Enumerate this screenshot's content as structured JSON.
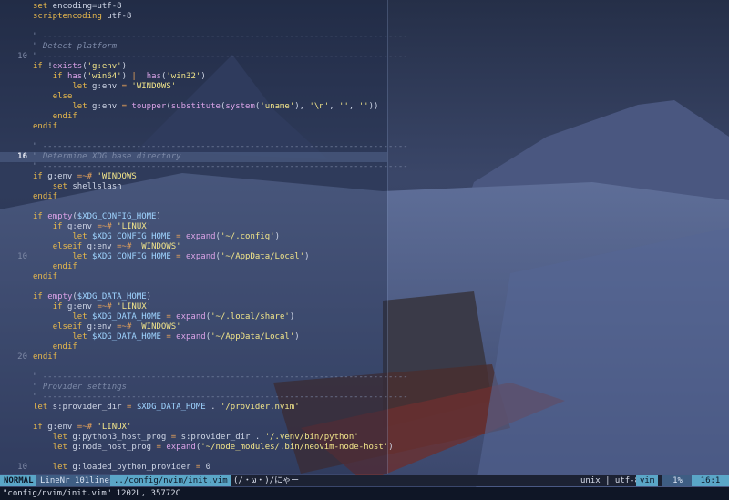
{
  "editor": {
    "lines": [
      {
        "n": "",
        "cur": false,
        "segs": [
          [
            "kw",
            "set"
          ],
          [
            "txt",
            " encoding=utf-8"
          ]
        ]
      },
      {
        "n": "",
        "cur": false,
        "segs": [
          [
            "kw",
            "scriptencoding"
          ],
          [
            "txt",
            " utf-8"
          ]
        ]
      },
      {
        "n": "",
        "cur": false,
        "segs": []
      },
      {
        "n": "",
        "cur": false,
        "segs": [
          [
            "cmt",
            "\" --------------------------------------------------------------------------"
          ]
        ]
      },
      {
        "n": "",
        "cur": false,
        "segs": [
          [
            "cmt",
            "\" Detect platform"
          ]
        ]
      },
      {
        "n": "10",
        "cur": false,
        "segs": [
          [
            "cmt",
            "\" --------------------------------------------------------------------------"
          ]
        ]
      },
      {
        "n": "",
        "cur": false,
        "segs": [
          [
            "kw",
            "if"
          ],
          [
            "txt",
            " !"
          ],
          [
            "fn",
            "exists"
          ],
          [
            "txt",
            "("
          ],
          [
            "str",
            "'g:env'"
          ],
          [
            "txt",
            ")"
          ]
        ]
      },
      {
        "n": "",
        "cur": false,
        "segs": [
          [
            "txt",
            "    "
          ],
          [
            "kw",
            "if"
          ],
          [
            "txt",
            " "
          ],
          [
            "fn",
            "has"
          ],
          [
            "txt",
            "("
          ],
          [
            "str",
            "'win64'"
          ],
          [
            "txt",
            ") "
          ],
          [
            "op",
            "||"
          ],
          [
            "txt",
            " "
          ],
          [
            "fn",
            "has"
          ],
          [
            "txt",
            "("
          ],
          [
            "str",
            "'win32'"
          ],
          [
            "txt",
            ")"
          ]
        ]
      },
      {
        "n": "",
        "cur": false,
        "segs": [
          [
            "txt",
            "        "
          ],
          [
            "kw",
            "let"
          ],
          [
            "txt",
            " g:env "
          ],
          [
            "op",
            "="
          ],
          [
            "txt",
            " "
          ],
          [
            "str",
            "'WINDOWS'"
          ]
        ]
      },
      {
        "n": "",
        "cur": false,
        "segs": [
          [
            "txt",
            "    "
          ],
          [
            "kw",
            "else"
          ]
        ]
      },
      {
        "n": "",
        "cur": false,
        "segs": [
          [
            "txt",
            "        "
          ],
          [
            "kw",
            "let"
          ],
          [
            "txt",
            " g:env "
          ],
          [
            "op",
            "="
          ],
          [
            "txt",
            " "
          ],
          [
            "fn",
            "toupper"
          ],
          [
            "txt",
            "("
          ],
          [
            "fn",
            "substitute"
          ],
          [
            "txt",
            "("
          ],
          [
            "fn",
            "system"
          ],
          [
            "txt",
            "("
          ],
          [
            "str",
            "'uname'"
          ],
          [
            "txt",
            "), "
          ],
          [
            "str",
            "'\\n'"
          ],
          [
            "txt",
            ", "
          ],
          [
            "str",
            "''"
          ],
          [
            "txt",
            ", "
          ],
          [
            "str",
            "''"
          ],
          [
            "txt",
            "))"
          ]
        ]
      },
      {
        "n": "",
        "cur": false,
        "segs": [
          [
            "txt",
            "    "
          ],
          [
            "kw",
            "endif"
          ]
        ]
      },
      {
        "n": "",
        "cur": false,
        "segs": [
          [
            "kw",
            "endif"
          ]
        ]
      },
      {
        "n": "",
        "cur": false,
        "segs": []
      },
      {
        "n": "",
        "cur": false,
        "segs": [
          [
            "cmt",
            "\" --------------------------------------------------------------------------"
          ]
        ]
      },
      {
        "n": "16",
        "cur": true,
        "segs": [
          [
            "cmt",
            "\" Determine XDG base directory"
          ]
        ]
      },
      {
        "n": "",
        "cur": false,
        "segs": [
          [
            "cmt",
            "\" --------------------------------------------------------------------------"
          ]
        ]
      },
      {
        "n": "",
        "cur": false,
        "segs": [
          [
            "kw",
            "if"
          ],
          [
            "txt",
            " g:env "
          ],
          [
            "op",
            "=~#"
          ],
          [
            "txt",
            " "
          ],
          [
            "str",
            "'WINDOWS'"
          ]
        ]
      },
      {
        "n": "",
        "cur": false,
        "segs": [
          [
            "txt",
            "    "
          ],
          [
            "kw",
            "set"
          ],
          [
            "txt",
            " shellslash"
          ]
        ]
      },
      {
        "n": "",
        "cur": false,
        "segs": [
          [
            "kw",
            "endif"
          ]
        ]
      },
      {
        "n": "",
        "cur": false,
        "segs": []
      },
      {
        "n": "",
        "cur": false,
        "segs": [
          [
            "kw",
            "if"
          ],
          [
            "txt",
            " "
          ],
          [
            "fn",
            "empty"
          ],
          [
            "txt",
            "("
          ],
          [
            "var",
            "$XDG_CONFIG_HOME"
          ],
          [
            "txt",
            ")"
          ]
        ]
      },
      {
        "n": "",
        "cur": false,
        "segs": [
          [
            "txt",
            "    "
          ],
          [
            "kw",
            "if"
          ],
          [
            "txt",
            " g:env "
          ],
          [
            "op",
            "=~#"
          ],
          [
            "txt",
            " "
          ],
          [
            "str",
            "'LINUX'"
          ]
        ]
      },
      {
        "n": "",
        "cur": false,
        "segs": [
          [
            "txt",
            "        "
          ],
          [
            "kw",
            "let"
          ],
          [
            "txt",
            " "
          ],
          [
            "var",
            "$XDG_CONFIG_HOME"
          ],
          [
            "txt",
            " "
          ],
          [
            "op",
            "="
          ],
          [
            "txt",
            " "
          ],
          [
            "fn",
            "expand"
          ],
          [
            "txt",
            "("
          ],
          [
            "str",
            "'~/.config'"
          ],
          [
            "txt",
            ")"
          ]
        ]
      },
      {
        "n": "",
        "cur": false,
        "segs": [
          [
            "txt",
            "    "
          ],
          [
            "kw",
            "elseif"
          ],
          [
            "txt",
            " g:env "
          ],
          [
            "op",
            "=~#"
          ],
          [
            "txt",
            " "
          ],
          [
            "str",
            "'WINDOWS'"
          ]
        ]
      },
      {
        "n": "10",
        "cur": false,
        "segs": [
          [
            "txt",
            "        "
          ],
          [
            "kw",
            "let"
          ],
          [
            "txt",
            " "
          ],
          [
            "var",
            "$XDG_CONFIG_HOME"
          ],
          [
            "txt",
            " "
          ],
          [
            "op",
            "="
          ],
          [
            "txt",
            " "
          ],
          [
            "fn",
            "expand"
          ],
          [
            "txt",
            "("
          ],
          [
            "str",
            "'~/AppData/Local'"
          ],
          [
            "txt",
            ")"
          ]
        ]
      },
      {
        "n": "",
        "cur": false,
        "segs": [
          [
            "txt",
            "    "
          ],
          [
            "kw",
            "endif"
          ]
        ]
      },
      {
        "n": "",
        "cur": false,
        "segs": [
          [
            "kw",
            "endif"
          ]
        ]
      },
      {
        "n": "",
        "cur": false,
        "segs": []
      },
      {
        "n": "",
        "cur": false,
        "segs": [
          [
            "kw",
            "if"
          ],
          [
            "txt",
            " "
          ],
          [
            "fn",
            "empty"
          ],
          [
            "txt",
            "("
          ],
          [
            "var",
            "$XDG_DATA_HOME"
          ],
          [
            "txt",
            ")"
          ]
        ]
      },
      {
        "n": "",
        "cur": false,
        "segs": [
          [
            "txt",
            "    "
          ],
          [
            "kw",
            "if"
          ],
          [
            "txt",
            " g:env "
          ],
          [
            "op",
            "=~#"
          ],
          [
            "txt",
            " "
          ],
          [
            "str",
            "'LINUX'"
          ]
        ]
      },
      {
        "n": "",
        "cur": false,
        "segs": [
          [
            "txt",
            "        "
          ],
          [
            "kw",
            "let"
          ],
          [
            "txt",
            " "
          ],
          [
            "var",
            "$XDG_DATA_HOME"
          ],
          [
            "txt",
            " "
          ],
          [
            "op",
            "="
          ],
          [
            "txt",
            " "
          ],
          [
            "fn",
            "expand"
          ],
          [
            "txt",
            "("
          ],
          [
            "str",
            "'~/.local/share'"
          ],
          [
            "txt",
            ")"
          ]
        ]
      },
      {
        "n": "",
        "cur": false,
        "segs": [
          [
            "txt",
            "    "
          ],
          [
            "kw",
            "elseif"
          ],
          [
            "txt",
            " g:env "
          ],
          [
            "op",
            "=~#"
          ],
          [
            "txt",
            " "
          ],
          [
            "str",
            "'WINDOWS'"
          ]
        ]
      },
      {
        "n": "",
        "cur": false,
        "segs": [
          [
            "txt",
            "        "
          ],
          [
            "kw",
            "let"
          ],
          [
            "txt",
            " "
          ],
          [
            "var",
            "$XDG_DATA_HOME"
          ],
          [
            "txt",
            " "
          ],
          [
            "op",
            "="
          ],
          [
            "txt",
            " "
          ],
          [
            "fn",
            "expand"
          ],
          [
            "txt",
            "("
          ],
          [
            "str",
            "'~/AppData/Local'"
          ],
          [
            "txt",
            ")"
          ]
        ]
      },
      {
        "n": "",
        "cur": false,
        "segs": [
          [
            "txt",
            "    "
          ],
          [
            "kw",
            "endif"
          ]
        ]
      },
      {
        "n": "20",
        "cur": false,
        "segs": [
          [
            "kw",
            "endif"
          ]
        ]
      },
      {
        "n": "",
        "cur": false,
        "segs": []
      },
      {
        "n": "",
        "cur": false,
        "segs": [
          [
            "cmt",
            "\" --------------------------------------------------------------------------"
          ]
        ]
      },
      {
        "n": "",
        "cur": false,
        "segs": [
          [
            "cmt",
            "\" Provider settings"
          ]
        ]
      },
      {
        "n": "",
        "cur": false,
        "segs": [
          [
            "cmt",
            "\" --------------------------------------------------------------------------"
          ]
        ]
      },
      {
        "n": "",
        "cur": false,
        "segs": [
          [
            "kw",
            "let"
          ],
          [
            "txt",
            " s:provider_dir "
          ],
          [
            "op",
            "="
          ],
          [
            "txt",
            " "
          ],
          [
            "var",
            "$XDG_DATA_HOME"
          ],
          [
            "txt",
            " . "
          ],
          [
            "str",
            "'/provider.nvim'"
          ]
        ]
      },
      {
        "n": "",
        "cur": false,
        "segs": []
      },
      {
        "n": "",
        "cur": false,
        "segs": [
          [
            "kw",
            "if"
          ],
          [
            "txt",
            " g:env "
          ],
          [
            "op",
            "=~#"
          ],
          [
            "txt",
            " "
          ],
          [
            "str",
            "'LINUX'"
          ]
        ]
      },
      {
        "n": "",
        "cur": false,
        "segs": [
          [
            "txt",
            "    "
          ],
          [
            "kw",
            "let"
          ],
          [
            "txt",
            " g:python3_host_prog "
          ],
          [
            "op",
            "="
          ],
          [
            "txt",
            " s:provider_dir . "
          ],
          [
            "str",
            "'/.venv/bin/python'"
          ]
        ]
      },
      {
        "n": "",
        "cur": false,
        "segs": [
          [
            "txt",
            "    "
          ],
          [
            "kw",
            "let"
          ],
          [
            "txt",
            " g:node_host_prog "
          ],
          [
            "op",
            "="
          ],
          [
            "txt",
            " "
          ],
          [
            "fn",
            "expand"
          ],
          [
            "txt",
            "("
          ],
          [
            "str",
            "'~/node_modules/.bin/neovim-node-host'"
          ],
          [
            "txt",
            ")"
          ]
        ]
      },
      {
        "n": "",
        "cur": false,
        "segs": []
      },
      {
        "n": "10",
        "cur": false,
        "segs": [
          [
            "txt",
            "    "
          ],
          [
            "kw",
            "let"
          ],
          [
            "txt",
            " g:loaded_python_provider "
          ],
          [
            "op",
            "="
          ],
          [
            "txt",
            " 0"
          ]
        ]
      }
    ]
  },
  "statusline": {
    "mode": "NORMAL",
    "linenr": "LineNr 101lines",
    "path": "../config/nvim/init.vim",
    "face": "(/・ω・)/にゃー",
    "fileformat": "unix | utf-8",
    "filetype": "vim",
    "percent": "1%",
    "position": "16:1"
  },
  "cmdline": {
    "message": "\"config/nvim/init.vim\" 1202L, 35772C"
  },
  "colors": {
    "accent": "#5aa6c7",
    "accent_dark": "#3e5d83",
    "keyword": "#e8b94c",
    "string": "#f2e58a",
    "function": "#d9a2e6",
    "comment": "#7d8aa8"
  }
}
